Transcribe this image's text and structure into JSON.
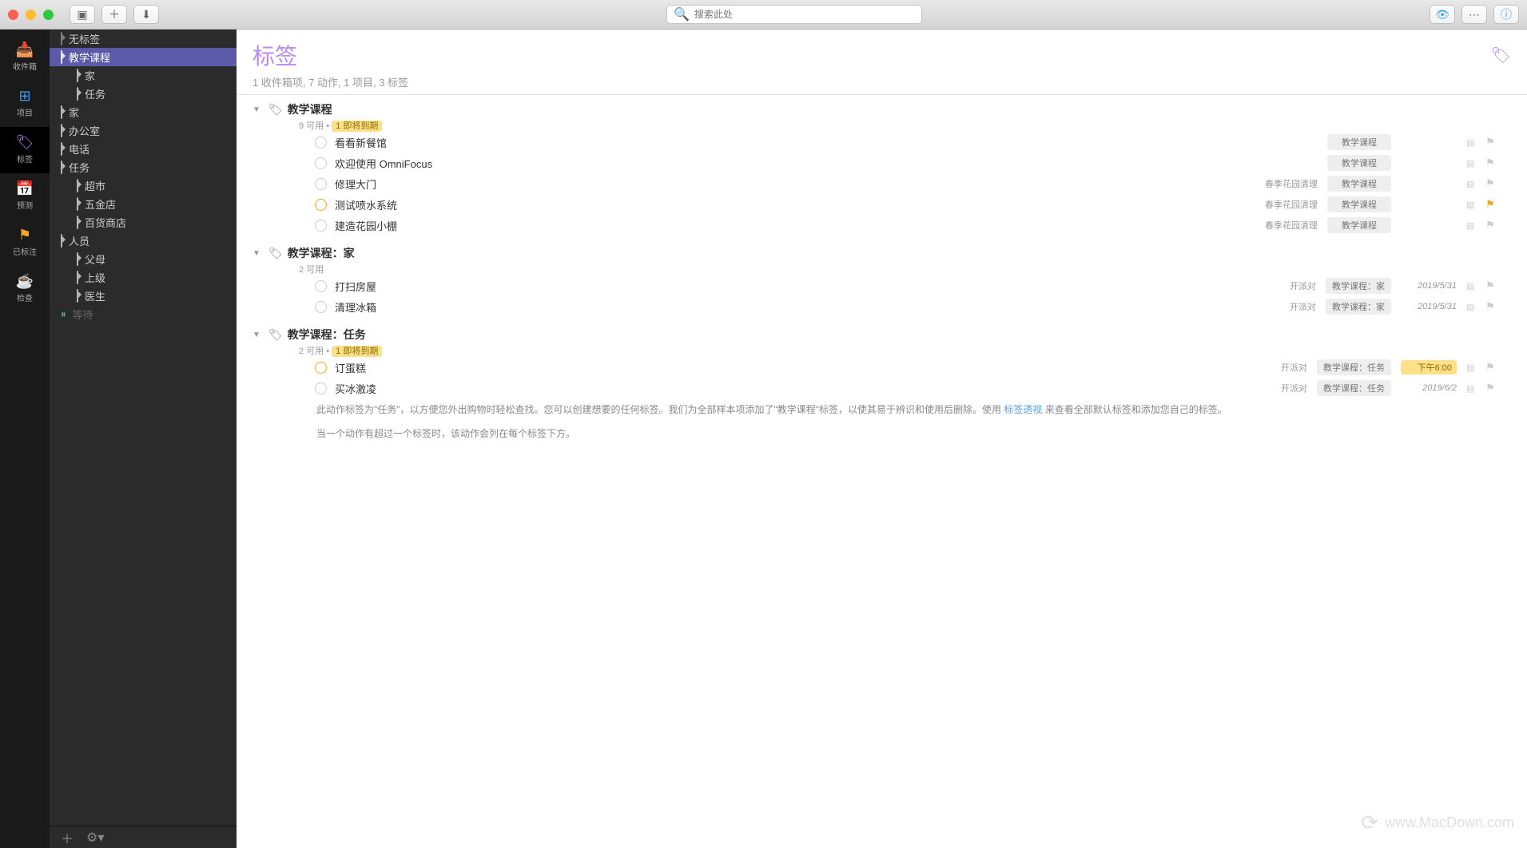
{
  "titlebar": {
    "search_placeholder": "搜索此处"
  },
  "rail": [
    {
      "icon": "inbox",
      "label": "收件箱",
      "color": "#7b8ce8"
    },
    {
      "icon": "projects",
      "label": "项目",
      "color": "#3b9cf0"
    },
    {
      "icon": "tags",
      "label": "标签",
      "color": "#b88cf0",
      "active": true
    },
    {
      "icon": "forecast",
      "label": "预测",
      "color": "#e85d5d"
    },
    {
      "icon": "flagged",
      "label": "已标注",
      "color": "#f5a623"
    },
    {
      "icon": "review",
      "label": "检查",
      "color": "#5ac8d8"
    }
  ],
  "sidebar": {
    "items": [
      {
        "label": "无标签",
        "icon": "notag",
        "level": 0
      },
      {
        "label": "教学课程",
        "icon": "tag",
        "level": 0,
        "selected": true
      },
      {
        "label": "家",
        "icon": "tag",
        "level": 1
      },
      {
        "label": "任务",
        "icon": "tag",
        "level": 1
      },
      {
        "label": "家",
        "icon": "tag",
        "level": 0
      },
      {
        "label": "办公室",
        "icon": "tag",
        "level": 0
      },
      {
        "label": "电话",
        "icon": "tag",
        "level": 0
      },
      {
        "label": "任务",
        "icon": "tag",
        "level": 0
      },
      {
        "label": "超市",
        "icon": "tag",
        "level": 1
      },
      {
        "label": "五金店",
        "icon": "tag",
        "level": 1
      },
      {
        "label": "百货商店",
        "icon": "tag",
        "level": 1
      },
      {
        "label": "人员",
        "icon": "tag",
        "level": 0
      },
      {
        "label": "父母",
        "icon": "tag",
        "level": 1
      },
      {
        "label": "上级",
        "icon": "tag",
        "level": 1
      },
      {
        "label": "医生",
        "icon": "tag",
        "level": 1
      },
      {
        "label": "等待",
        "icon": "pause",
        "level": 0,
        "muted": true
      }
    ]
  },
  "header": {
    "title": "标签",
    "subtitle": "1 收件箱项, 7 动作, 1 项目, 3 标签"
  },
  "groups": [
    {
      "title": "教学课程",
      "sub_count": "9 可用",
      "due_badge": "1 即将到期",
      "tasks": [
        {
          "title": "看看新餐馆",
          "project": "",
          "tag": "教学课程",
          "date": "",
          "flagged": false,
          "chk": ""
        },
        {
          "title": "欢迎使用 OmniFocus",
          "project": "",
          "tag": "教学课程",
          "date": "",
          "flagged": false,
          "chk": ""
        },
        {
          "title": "修理大门",
          "project": "春季花园清理",
          "tag": "教学课程",
          "date": "",
          "flagged": false,
          "chk": ""
        },
        {
          "title": "测试喷水系统",
          "project": "春季花园清理",
          "tag": "教学课程",
          "date": "",
          "flagged": true,
          "chk": "orange"
        },
        {
          "title": "建造花园小棚",
          "project": "春季花园清理",
          "tag": "教学课程",
          "date": "",
          "flagged": false,
          "chk": ""
        }
      ]
    },
    {
      "title": "教学课程：家",
      "sub_count": "2 可用",
      "due_badge": "",
      "tasks": [
        {
          "title": "打扫房屋",
          "project": "开派对",
          "tag": "教学课程：家",
          "date": "2019/5/31",
          "flagged": false,
          "chk": ""
        },
        {
          "title": "清理冰箱",
          "project": "开派对",
          "tag": "教学课程：家",
          "date": "2019/5/31",
          "flagged": false,
          "chk": ""
        }
      ]
    },
    {
      "title": "教学课程：任务",
      "sub_count": "2 可用",
      "due_badge": "1 即将到期",
      "tasks": [
        {
          "title": "订蛋糕",
          "project": "开派对",
          "tag": "教学课程：任务",
          "date": "下午6:00",
          "date_due": true,
          "flagged": false,
          "chk": "orange"
        },
        {
          "title": "买冰激凌",
          "project": "开派对",
          "tag": "教学课程：任务",
          "date": "2019/6/2",
          "flagged": false,
          "chk": ""
        }
      ]
    }
  ],
  "description": {
    "line1a": "此动作标签为\"任务\"，以方便您外出购物时轻松查找。您可以创建想要的任何标签。我们为全部样本项添加了\"教学课程\"标签，以使其易于辨识和使用后删除。使用 ",
    "link": "标签透视",
    "line1b": " 来查看全部默认标签和添加您自己的标签。",
    "line2": "当一个动作有超过一个标签时，该动作会列在每个标签下方。"
  },
  "watermark": "www.MacDown.com"
}
